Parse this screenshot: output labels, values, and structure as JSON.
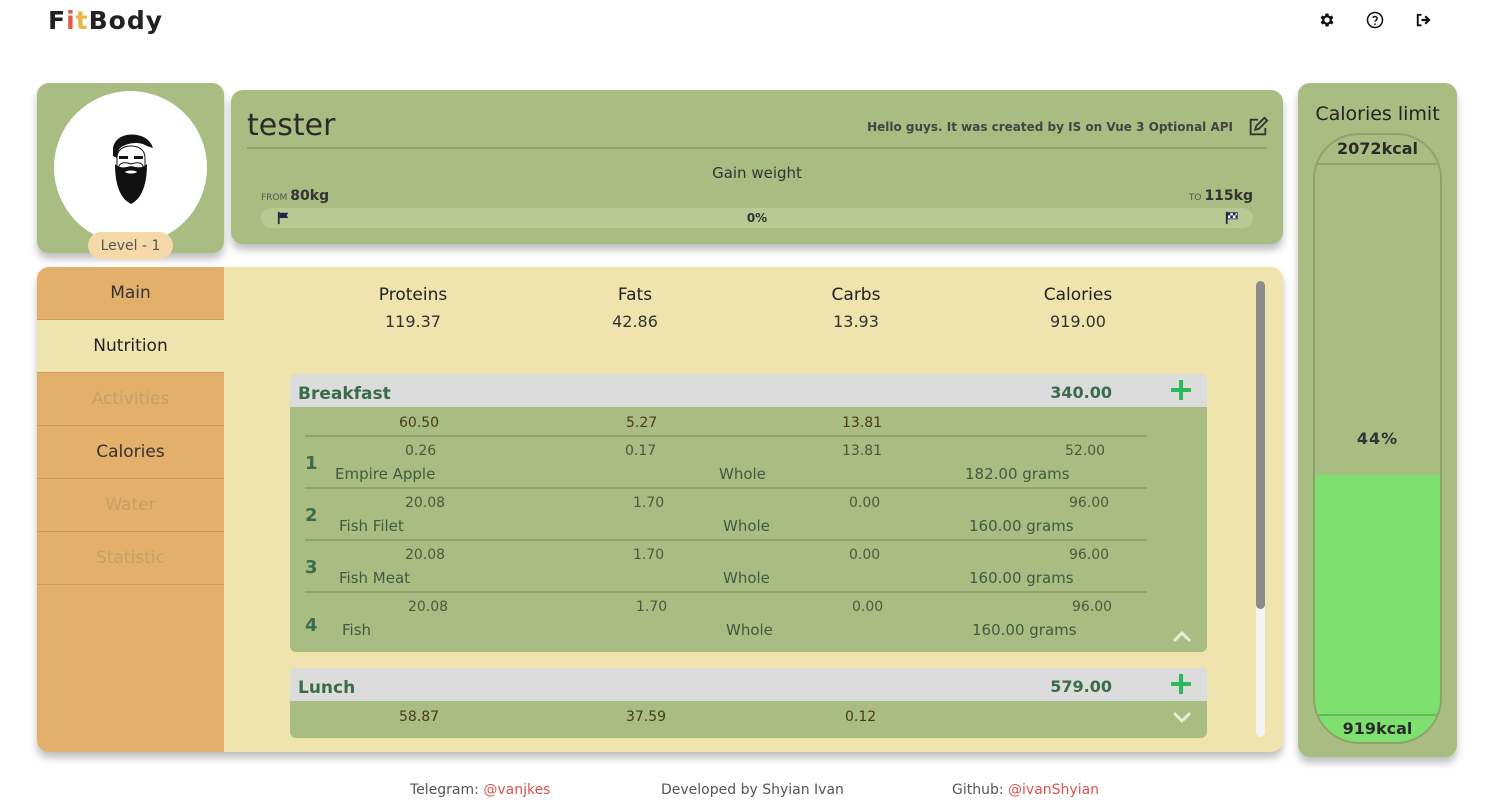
{
  "header": {
    "logo": {
      "part1": "F",
      "part2": "i",
      "part3": "t",
      "part4": "Body"
    },
    "icons": [
      "gear-icon",
      "help-icon",
      "logout-icon"
    ]
  },
  "profile": {
    "level": "Level - 1",
    "username": "tester",
    "tagline": "Hello guys. It was created by IS on Vue 3 Optional API",
    "goal": "Gain weight",
    "from_caption": "FROM",
    "from_value": "80kg",
    "to_caption": "TO",
    "to_value": "115kg",
    "progress_text": "0%",
    "progress_fraction": 0
  },
  "sidebar": {
    "items": [
      {
        "label": "Main"
      },
      {
        "label": "Nutrition"
      },
      {
        "label": "Activities"
      },
      {
        "label": "Calories"
      },
      {
        "label": "Water"
      },
      {
        "label": "Statistic"
      }
    ]
  },
  "totals": {
    "headers": [
      "Proteins",
      "Fats",
      "Carbs",
      "Calories"
    ],
    "values": [
      "119.37",
      "42.86",
      "13.93",
      "919.00"
    ]
  },
  "meals": [
    {
      "title": "Breakfast",
      "calories": "340.00",
      "sum": [
        "60.50",
        "5.27",
        "13.81"
      ],
      "items": [
        {
          "idx": "1",
          "p": "0.26",
          "f": "0.17",
          "c": "13.81",
          "kcal": "52.00",
          "name": "Empire Apple",
          "unit": "Whole",
          "amount": "182.00 grams"
        },
        {
          "idx": "2",
          "p": "20.08",
          "f": "1.70",
          "c": "0.00",
          "kcal": "96.00",
          "name": "Fish Filet",
          "unit": "Whole",
          "amount": "160.00 grams"
        },
        {
          "idx": "3",
          "p": "20.08",
          "f": "1.70",
          "c": "0.00",
          "kcal": "96.00",
          "name": "Fish Meat",
          "unit": "Whole",
          "amount": "160.00 grams"
        },
        {
          "idx": "4",
          "p": "20.08",
          "f": "1.70",
          "c": "0.00",
          "kcal": "96.00",
          "name": "Fish",
          "unit": "Whole",
          "amount": "160.00 grams"
        }
      ]
    },
    {
      "title": "Lunch",
      "calories": "579.00",
      "sum": [
        "58.87",
        "37.59",
        "0.12"
      ]
    }
  ],
  "limit": {
    "title": "Calories limit",
    "max": "2072kcal",
    "percent": "44%",
    "fill_fraction": 0.44,
    "current": "919kcal"
  },
  "footer": {
    "telegram_label": "Telegram:",
    "telegram_link": "@vanjkes",
    "developer": "Developed by Shyian Ivan",
    "github_label": "Github:",
    "github_link": "@ivanShyian"
  },
  "colors": {
    "card_green": "#a9bd82",
    "panel_cream": "#efe3ae",
    "sidebar_orange": "#e2b06b",
    "fill_green": "#7de06f",
    "accent_green": "#2eb85c",
    "link_red": "#d9534f"
  }
}
